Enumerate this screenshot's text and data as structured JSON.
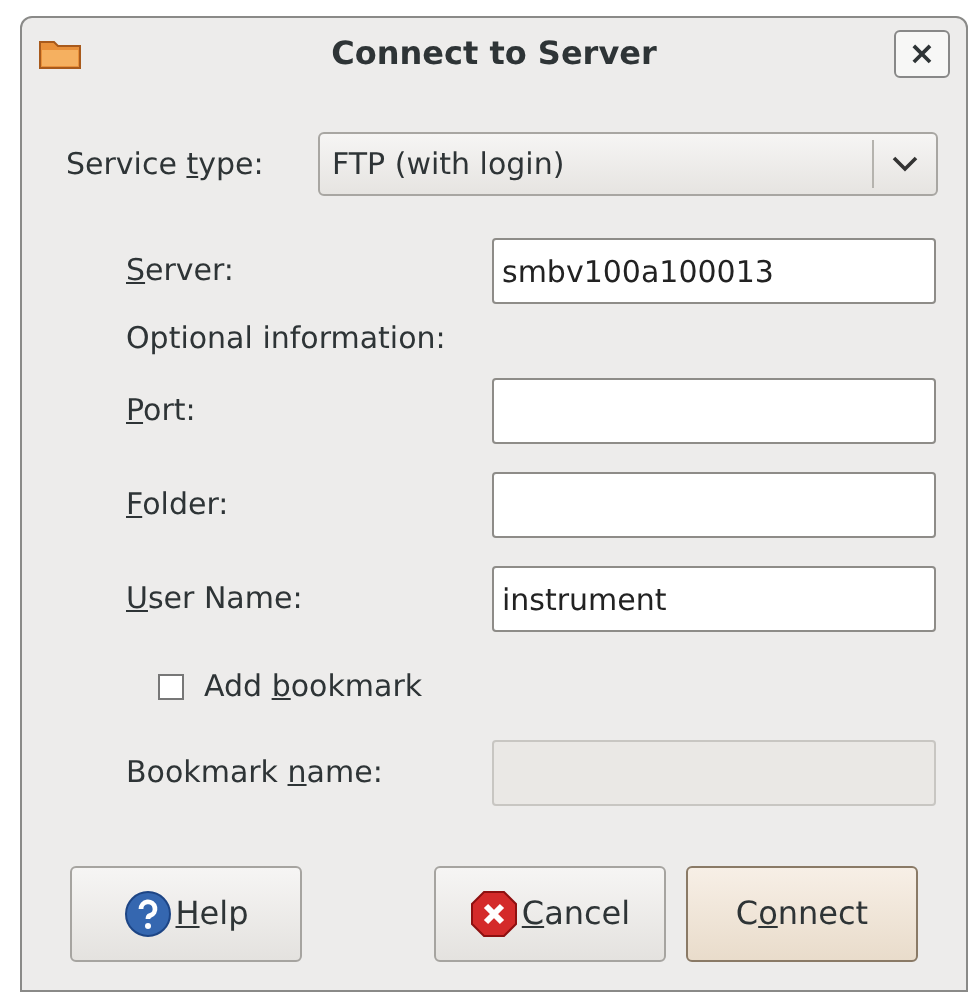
{
  "window": {
    "title": "Connect to Server",
    "close": "×"
  },
  "service_type": {
    "label": {
      "pre": "Service ",
      "key": "t",
      "post": "ype:"
    },
    "value": "FTP (with login)"
  },
  "fields": [
    {
      "kind": "field",
      "label": {
        "key": "S",
        "post": "erver:"
      },
      "value": "smbv100a100013",
      "disabled": false
    },
    {
      "kind": "heading",
      "label": {
        "pre": "Optional information:"
      }
    },
    {
      "kind": "field",
      "label": {
        "key": "P",
        "post": "ort:"
      },
      "disabled": false
    },
    {
      "kind": "field",
      "label": {
        "key": "F",
        "post": "older:"
      },
      "disabled": false
    },
    {
      "kind": "field",
      "label": {
        "key": "U",
        "post": "ser Name:"
      },
      "value": "instrument",
      "disabled": false
    },
    {
      "kind": "checkbox",
      "label": {
        "pre": "Add ",
        "key": "b",
        "post": "ookmark"
      },
      "checked": false
    },
    {
      "kind": "field",
      "label": {
        "pre": "Bookmark ",
        "key": "n",
        "post": "ame:"
      },
      "disabled": true
    }
  ],
  "buttons": [
    {
      "kind": "help",
      "label": {
        "key": "H",
        "post": "elp"
      },
      "default": false
    },
    {
      "kind": "cancel",
      "label": {
        "key": "C",
        "post": "ancel"
      },
      "default": false
    },
    {
      "kind": "connect",
      "label": {
        "pre": "C",
        "key": "o",
        "post": "nnect"
      },
      "default": true
    }
  ]
}
